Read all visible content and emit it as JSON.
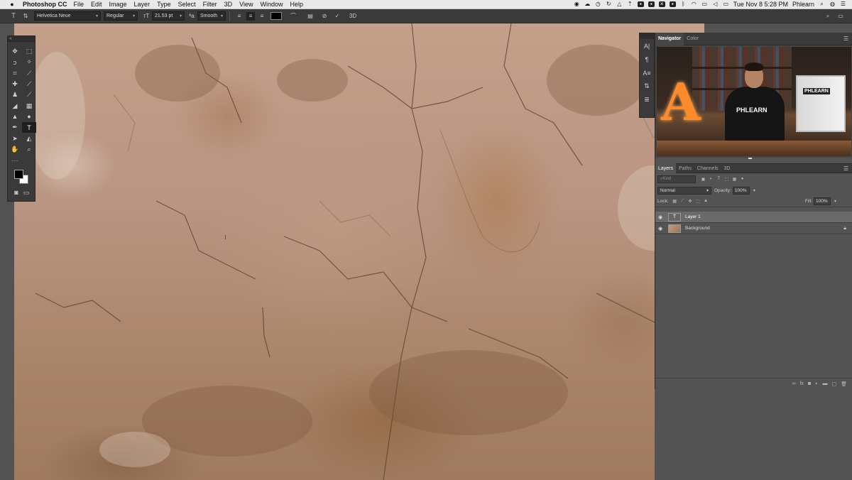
{
  "menubar": {
    "app_name": "Photoshop CC",
    "items": [
      "File",
      "Edit",
      "Image",
      "Layer",
      "Type",
      "Select",
      "Filter",
      "3D",
      "View",
      "Window",
      "Help"
    ],
    "clock": "Tue Nov 8  5:28 PM",
    "user": "Phlearn"
  },
  "options": {
    "font_family": "Helvetica Neue",
    "font_style": "Regular",
    "font_size": "21.53 pt",
    "antialias": "Smooth",
    "text_color": "#000000",
    "three_d_label": "3D"
  },
  "navigator": {
    "tabs": [
      "Navigator",
      "Color"
    ],
    "preview_person_text": "PHLEARN",
    "preview_monitor_text": "PHLEARN",
    "preview_letter": "A"
  },
  "layers_panel": {
    "tabs": [
      "Layers",
      "Paths",
      "Channels",
      "3D"
    ],
    "filter_placeholder": "Kind",
    "blend_mode": "Normal",
    "opacity_label": "Opacity:",
    "opacity_value": "100%",
    "lock_label": "Lock:",
    "fill_label": "Fill:",
    "fill_value": "100%",
    "layers": [
      {
        "name": "Layer 1",
        "type": "text",
        "selected": true
      },
      {
        "name": "Background",
        "type": "image",
        "locked": true
      }
    ]
  },
  "colors": {
    "accent": "#3a3a3a",
    "panel": "#535353",
    "foreground": "#000000",
    "background": "#ffffff"
  }
}
